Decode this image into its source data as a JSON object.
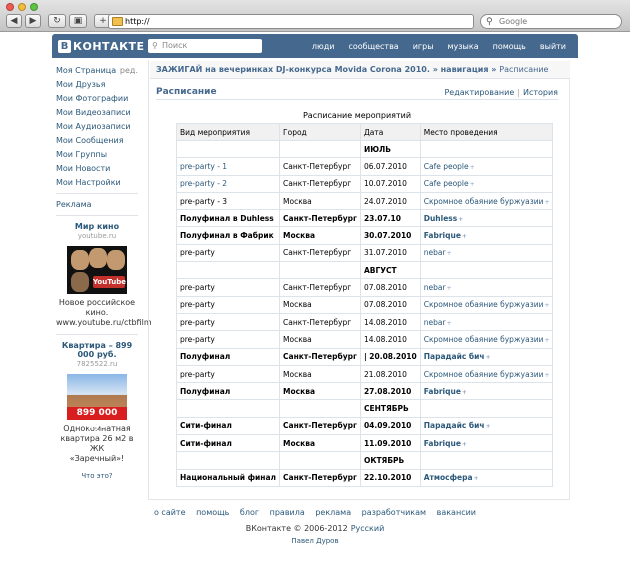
{
  "browser": {
    "url": "http://",
    "search_placeholder": "Google",
    "traffic_colors": [
      "#ee5b52",
      "#f3bd3b",
      "#5cc443"
    ],
    "nav_icons": [
      "back-arrow-icon",
      "forward-arrow-icon",
      "reload-icon",
      "screenshot-icon",
      "add-tab-icon"
    ]
  },
  "vk": {
    "brand_b": "В",
    "brand_word": "КОНТАКТЕ",
    "search_placeholder": "Поиск",
    "menu": [
      "люди",
      "сообщества",
      "игры",
      "музыка",
      "помощь",
      "выйти"
    ],
    "colors": {
      "header": "#45688e",
      "link": "#2b587a"
    }
  },
  "sidebar": {
    "items": [
      {
        "label": "Моя Страница",
        "extra": "ред."
      },
      {
        "label": "Мои Друзья"
      },
      {
        "label": "Мои Фотографии"
      },
      {
        "label": "Мои Видеозаписи"
      },
      {
        "label": "Мои Аудиозаписи"
      },
      {
        "label": "Мои Сообщения"
      },
      {
        "label": "Мои Группы"
      },
      {
        "label": "Мои Новости"
      },
      {
        "label": "Мои Настройки"
      }
    ],
    "ads_link": "Реклама",
    "ad1": {
      "title": "Мир кино",
      "domain": "youtube.ru",
      "yt": "YouTube",
      "text1": "Новое российское",
      "text2": "кино.",
      "text3": "www.youtube.ru/ctbfilm"
    },
    "ad2": {
      "title": "Квартира – 899 000 руб.",
      "domain": "7825522.ru",
      "price": "899 000 руб",
      "text1": "Однокомнатная",
      "text2": "квартира 26 м2 в ЖК",
      "text3": "«Заречный»!"
    },
    "what_is": "Что это?"
  },
  "main": {
    "breadcrumb": {
      "group": "ЗАЖИГАЙ на вечеринках DJ-конкурса Movida Corona 2010.",
      "sep": "»",
      "nav": "навигация",
      "current": "Расписание"
    },
    "title": "Расписание",
    "actions": {
      "edit": "Редактирование",
      "sep": "|",
      "history": "История"
    },
    "caption": "Расписание мероприятий",
    "table": {
      "headers": [
        "Вид мероприятия",
        "Город",
        "Дата",
        "Место проведения"
      ],
      "rows": [
        {
          "type": "month",
          "date": "ИЮЛЬ"
        },
        {
          "event": "pre-party - 1",
          "event_link": true,
          "city": "Санкт-Петербург",
          "date": "06.07.2010",
          "venue": "Cafe people",
          "plus": "+"
        },
        {
          "event": "pre-party - 2",
          "event_link": true,
          "city": "Санкт-Петербург",
          "date": "10.07.2010",
          "venue": "Cafe people",
          "plus": "+"
        },
        {
          "event": "pre-party - 3",
          "city": "Москва",
          "date": "24.07.2010",
          "venue": "Скромное обаяние буржуазии",
          "plus": "+"
        },
        {
          "type": "bold",
          "event": "Полуфинал в Duhless",
          "city": "Санкт-Петербург",
          "date": "23.07.10",
          "venue": "Duhless",
          "plus": "+"
        },
        {
          "type": "bold",
          "event": "Полуфинал в Фабрик",
          "city": "Москва",
          "date": "30.07.2010",
          "venue": "Fabrique",
          "plus": "+"
        },
        {
          "event": "pre-party",
          "city": "Санкт-Петербург",
          "date": "31.07.2010",
          "venue": "nebar",
          "plus": "+"
        },
        {
          "type": "month",
          "date": "АВГУСТ"
        },
        {
          "event": "pre-party",
          "city": "Санкт-Петербург",
          "date": "07.08.2010",
          "venue": "nebar",
          "plus": "+"
        },
        {
          "event": "pre-party",
          "city": "Москва",
          "date": "07.08.2010",
          "venue": "Скромное обаяние буржуазии",
          "plus": "+"
        },
        {
          "event": "pre-party",
          "city": "Санкт-Петербург",
          "date": "14.08.2010",
          "venue": "nebar",
          "plus": "+"
        },
        {
          "event": "pre-party",
          "city": "Москва",
          "date": "14.08.2010",
          "venue": "Скромное обаяние буржуазии",
          "plus": "+"
        },
        {
          "type": "bold",
          "event": "Полуфинал",
          "city": "Санкт-Петербург",
          "date": "| 20.08.2010",
          "venue": "Парадайс бич",
          "plus": "+"
        },
        {
          "event": "pre-party",
          "city": "Москва",
          "date": "21.08.2010",
          "venue": "Скромное обаяние буржуазии",
          "plus": "+"
        },
        {
          "type": "bold",
          "event": "Полуфинал",
          "city": "Москва",
          "date": "27.08.2010",
          "venue": "Fabrique",
          "plus": "+"
        },
        {
          "type": "month",
          "date": "СЕНТЯБРЬ"
        },
        {
          "type": "bold",
          "event": "Сити-финал",
          "city": "Санкт-Петербург",
          "date": "04.09.2010",
          "venue": "Парадайс бич",
          "plus": "+"
        },
        {
          "type": "bold",
          "event": "Сити-финал",
          "city": "Москва",
          "date": "11.09.2010",
          "venue": "Fabrique",
          "plus": "+"
        },
        {
          "type": "month",
          "date": "ОКТЯБРЬ"
        },
        {
          "type": "bold",
          "event": "Национальный финал",
          "city": "Санкт-Петербург",
          "date": "22.10.2010",
          "venue": "Атмосфера",
          "plus": "+"
        }
      ]
    }
  },
  "footer": {
    "links": [
      "о сайте",
      "помощь",
      "блог",
      "правила",
      "реклама",
      "разработчикам",
      "вакансии"
    ],
    "copyright": "ВКонтакте © 2006-2012",
    "lang": "Русский",
    "author": "Павел Дуров"
  }
}
